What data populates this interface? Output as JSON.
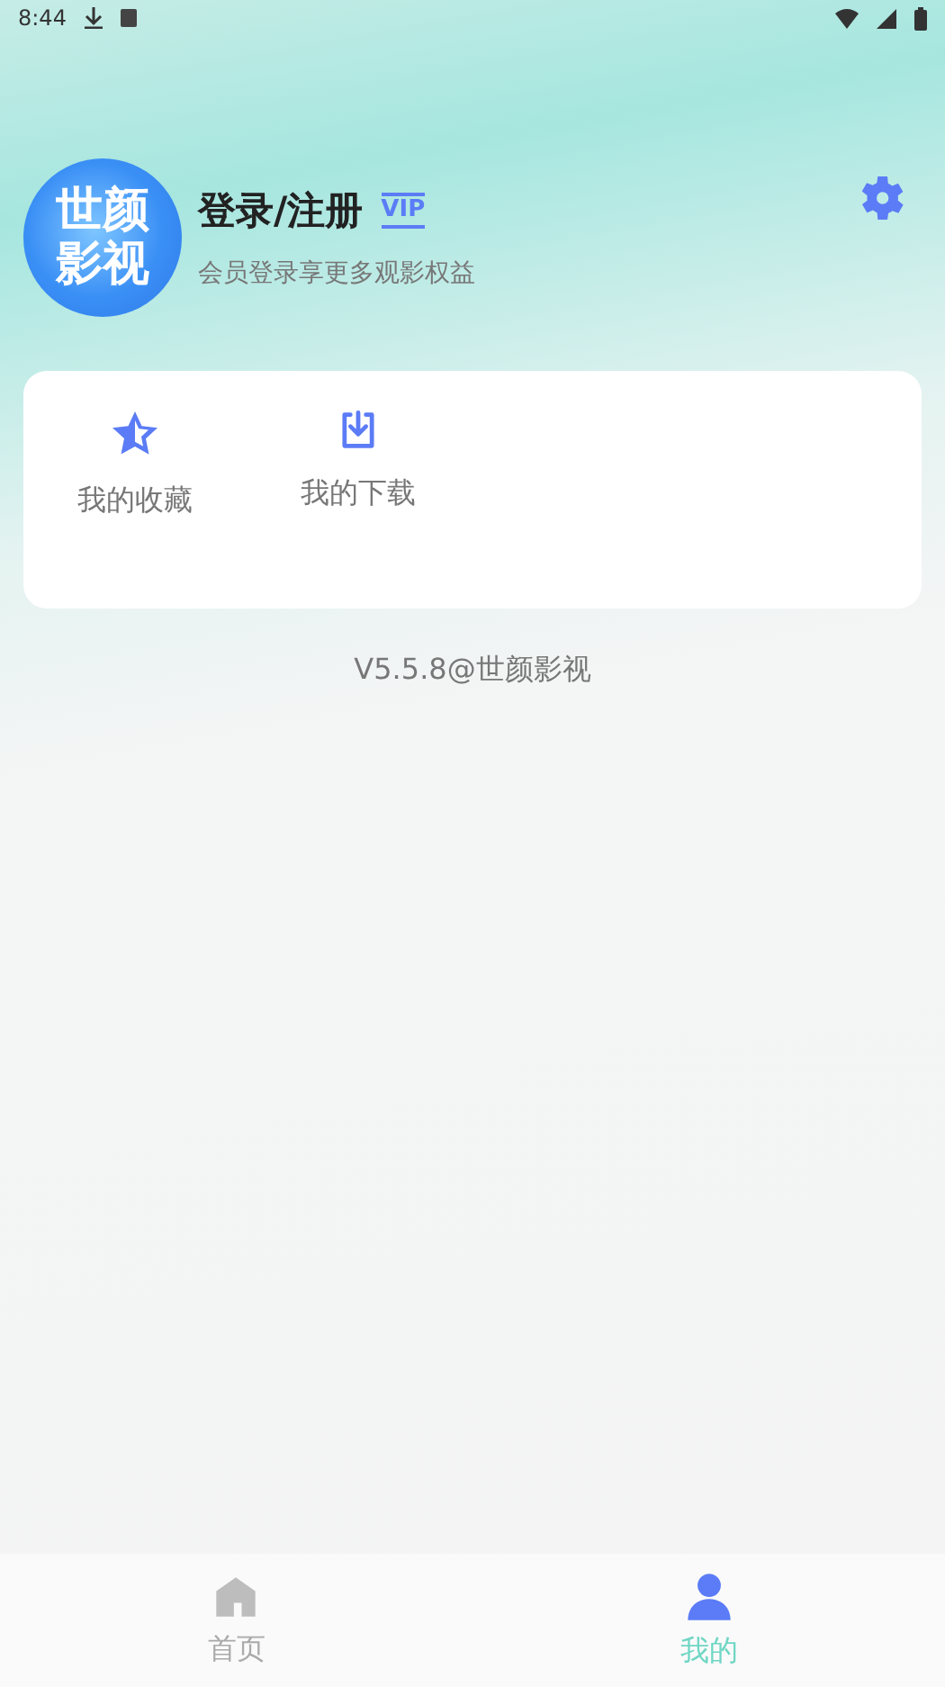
{
  "status_bar": {
    "time": "8:44"
  },
  "profile": {
    "avatar_text": [
      "世颜",
      "影视"
    ],
    "title": "登录/注册",
    "badge": "VIP",
    "subtitle": "会员登录享更多观影权益"
  },
  "shortcuts": [
    {
      "kind": "favorites",
      "label": "我的收藏"
    },
    {
      "kind": "downloads",
      "label": "我的下载"
    }
  ],
  "version": "V5.5.8@世颜影视",
  "tabs": [
    {
      "kind": "home",
      "label": "首页",
      "selected": false
    },
    {
      "kind": "me",
      "label": "我的",
      "selected": true
    }
  ]
}
